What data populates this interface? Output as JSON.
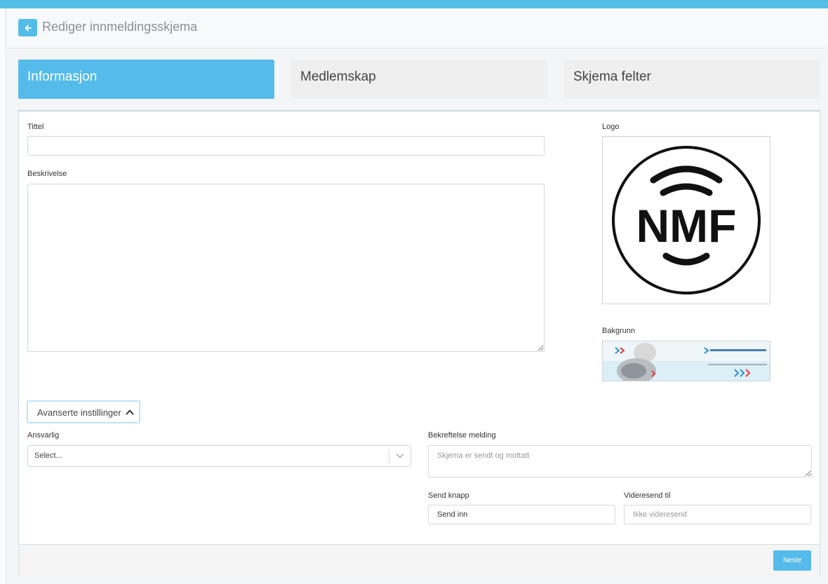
{
  "header": {
    "title": "Rediger innmeldingsskjema",
    "back_icon": "arrow-left-icon"
  },
  "tabs": [
    {
      "label": "Informasjon",
      "active": true
    },
    {
      "label": "Medlemskap",
      "active": false
    },
    {
      "label": "Skjema felter",
      "active": false
    }
  ],
  "form": {
    "title_label": "Tittel",
    "title_value": "",
    "description_label": "Beskrivelse",
    "description_value": "",
    "logo_label": "Logo",
    "logo_text": "NMF",
    "background_label": "Bakgrunn",
    "advanced_label": "Avanserte instillinger",
    "responsible_label": "Ansvarlig",
    "responsible_value": "Select...",
    "confirmation_label": "Bekreftelse melding",
    "confirmation_placeholder": "Skjema er sendt og mottatt",
    "send_button_label": "Send knapp",
    "send_button_value": "Send inn",
    "forward_label": "Videresend til",
    "forward_placeholder": "Ikke videresend"
  },
  "footer": {
    "next_label": "Neste"
  },
  "colors": {
    "accent": "#55bbea",
    "topbar": "#53bde8"
  }
}
